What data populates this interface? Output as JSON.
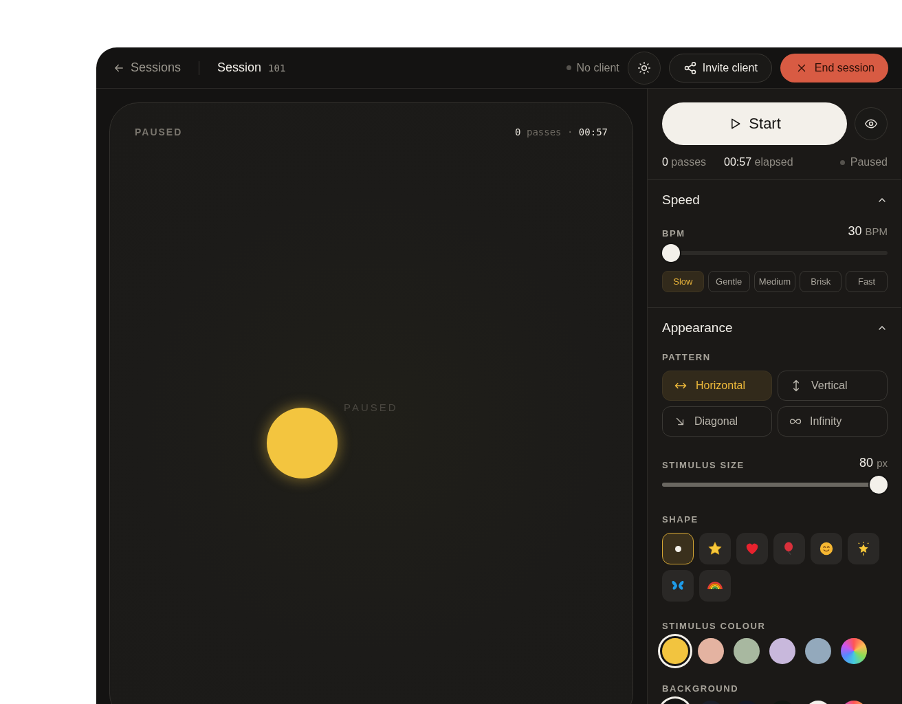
{
  "header": {
    "back_label": "Sessions",
    "title": "Session",
    "session_number": "101",
    "client_status": "No client",
    "invite_button": "Invite client",
    "end_button": "End session"
  },
  "stage": {
    "status": "PAUSED",
    "passes": "0",
    "passes_label": "passes",
    "separator": "·",
    "elapsed": "00:57",
    "center_label": "PAUSED"
  },
  "controls": {
    "start_button": "Start",
    "passes": {
      "value": "0",
      "label": "passes"
    },
    "elapsed": {
      "value": "00:57",
      "label": "elapsed"
    },
    "state": "Paused"
  },
  "speed": {
    "title": "Speed",
    "expanded": true,
    "label": "BPM",
    "value": "30",
    "unit": "BPM",
    "level": 0,
    "presets": [
      {
        "label": "Slow",
        "selected": true
      },
      {
        "label": "Gentle",
        "selected": false
      },
      {
        "label": "Medium",
        "selected": false
      },
      {
        "label": "Brisk",
        "selected": false
      },
      {
        "label": "Fast",
        "selected": false
      }
    ]
  },
  "appearance": {
    "title": "Appearance",
    "expanded": true,
    "pattern_label": "PATTERN",
    "patterns": [
      {
        "kind": "horizontal",
        "label": "Horizontal",
        "selected": true
      },
      {
        "kind": "vertical",
        "label": "Vertical",
        "selected": false
      },
      {
        "kind": "diagonal",
        "label": "Diagonal",
        "selected": false
      },
      {
        "kind": "infinity",
        "label": "Infinity",
        "selected": false
      }
    ],
    "size": {
      "label": "STIMULUS SIZE",
      "value": "80",
      "unit": "px",
      "level": 1
    },
    "shape_label": "SHAPE",
    "shapes": [
      {
        "kind": "dot",
        "selected": true
      },
      {
        "kind": "star",
        "selected": false
      },
      {
        "kind": "heart",
        "selected": false
      },
      {
        "kind": "balloon",
        "selected": false
      },
      {
        "kind": "smiley",
        "selected": false
      },
      {
        "kind": "sparkle-star",
        "selected": false
      },
      {
        "kind": "butterfly",
        "selected": false
      },
      {
        "kind": "rainbow",
        "selected": false
      }
    ],
    "colour_label": "STIMULUS COLOUR",
    "colours": [
      {
        "kind": "solid",
        "color": "#f2c43f",
        "selected": true
      },
      {
        "kind": "solid",
        "color": "#e4b3a1",
        "selected": false
      },
      {
        "kind": "solid",
        "color": "#a8b8a0",
        "selected": false
      },
      {
        "kind": "solid",
        "color": "#c8b8dc",
        "selected": false
      },
      {
        "kind": "solid",
        "color": "#93a9bc",
        "selected": false
      },
      {
        "kind": "spectrum",
        "selected": false
      }
    ],
    "background_label": "BACKGROUND",
    "backgrounds": [
      {
        "kind": "solid",
        "color": "#121312",
        "selected": true
      },
      {
        "kind": "solid",
        "color": "#1c1f29",
        "selected": false
      },
      {
        "kind": "solid",
        "color": "#141724",
        "selected": false
      },
      {
        "kind": "solid",
        "color": "#111611",
        "selected": false
      },
      {
        "kind": "solid",
        "color": "#f3f1ec",
        "selected": false
      },
      {
        "kind": "spectrum",
        "selected": false
      }
    ]
  }
}
